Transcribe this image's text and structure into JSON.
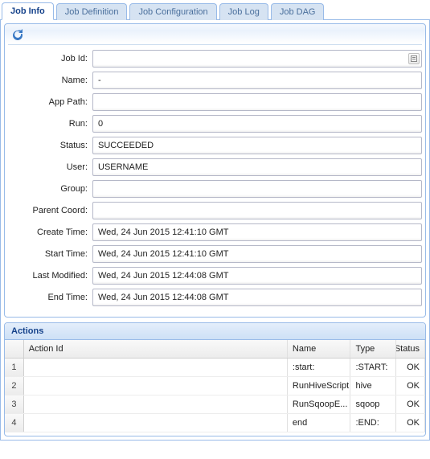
{
  "tabs": [
    {
      "label": "Job Info"
    },
    {
      "label": "Job Definition"
    },
    {
      "label": "Job Configuration"
    },
    {
      "label": "Job Log"
    },
    {
      "label": "Job DAG"
    }
  ],
  "active_tab": 0,
  "form": {
    "fields": [
      {
        "label": "Job Id:",
        "value": ""
      },
      {
        "label": "Name:",
        "value": "-"
      },
      {
        "label": "App Path:",
        "value": ""
      },
      {
        "label": "Run:",
        "value": "0"
      },
      {
        "label": "Status:",
        "value": "SUCCEEDED"
      },
      {
        "label": "User:",
        "value": "USERNAME"
      },
      {
        "label": "Group:",
        "value": ""
      },
      {
        "label": "Parent Coord:",
        "value": ""
      },
      {
        "label": "Create Time:",
        "value": "Wed, 24 Jun 2015 12:41:10 GMT"
      },
      {
        "label": "Start Time:",
        "value": "Wed, 24 Jun 2015 12:41:10 GMT"
      },
      {
        "label": "Last Modified:",
        "value": "Wed, 24 Jun 2015 12:44:08 GMT"
      },
      {
        "label": "End Time:",
        "value": "Wed, 24 Jun 2015 12:44:08 GMT"
      }
    ]
  },
  "actions": {
    "title": "Actions",
    "columns": [
      "",
      "Action Id",
      "Name",
      "Type",
      "Status"
    ],
    "rows": [
      {
        "n": "1",
        "action_id": "",
        "name": ":start:",
        "type": ":START:",
        "status": "OK"
      },
      {
        "n": "2",
        "action_id": "",
        "name": "RunHiveScript",
        "type": "hive",
        "status": "OK"
      },
      {
        "n": "3",
        "action_id": "",
        "name": "RunSqoopE...",
        "type": "sqoop",
        "status": "OK"
      },
      {
        "n": "4",
        "action_id": "",
        "name": "end",
        "type": ":END:",
        "status": "OK"
      }
    ]
  },
  "colors": {
    "border": "#99bbe8",
    "header_text": "#15428B"
  }
}
